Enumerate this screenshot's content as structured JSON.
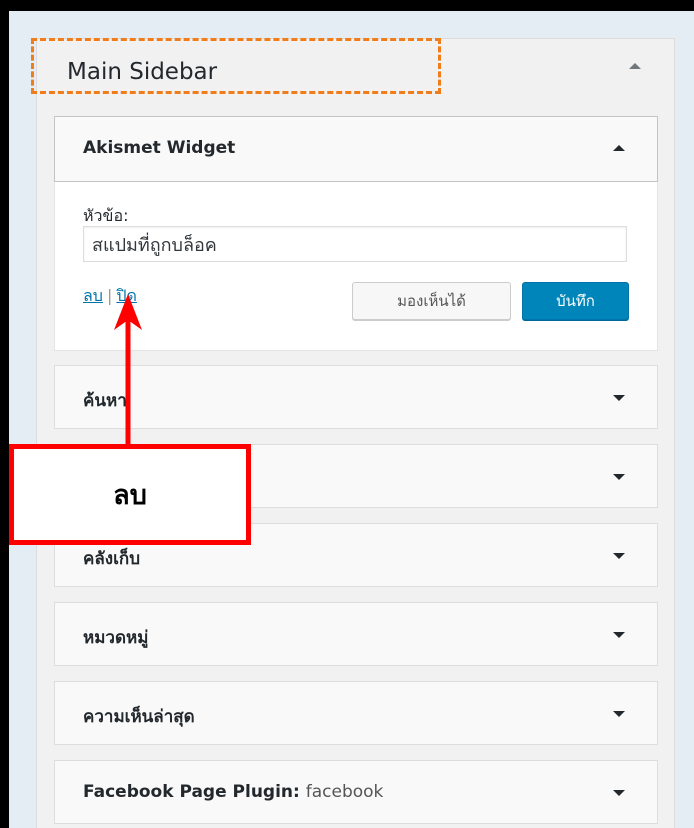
{
  "sidebar_area": {
    "title": "Main Sidebar",
    "toggle_icon": "caret-up-icon"
  },
  "open_widget": {
    "title": "Akismet Widget",
    "field_label": "หัวข้อ:",
    "field_value": "สแปมที่ถูกบล็อค",
    "delete_link": "ลบ",
    "separator": "|",
    "close_link": "ปิด",
    "visibility_button": "มองเห็นได้",
    "save_button": "บันทึก"
  },
  "widgets": [
    {
      "title": "ค้นหา"
    },
    {
      "title": ""
    },
    {
      "title": "คลังเก็บ"
    },
    {
      "title": "หมวดหมู่"
    },
    {
      "title": "ความเห็นล่าสุด"
    },
    {
      "title": "Facebook Page Plugin:",
      "subtitle": "facebook"
    }
  ],
  "annotation": {
    "callout_text": "ลบ",
    "callout_border_color": "#ff0000",
    "arrow_color": "#ff0000",
    "highlight_color": "#f07c1a"
  }
}
